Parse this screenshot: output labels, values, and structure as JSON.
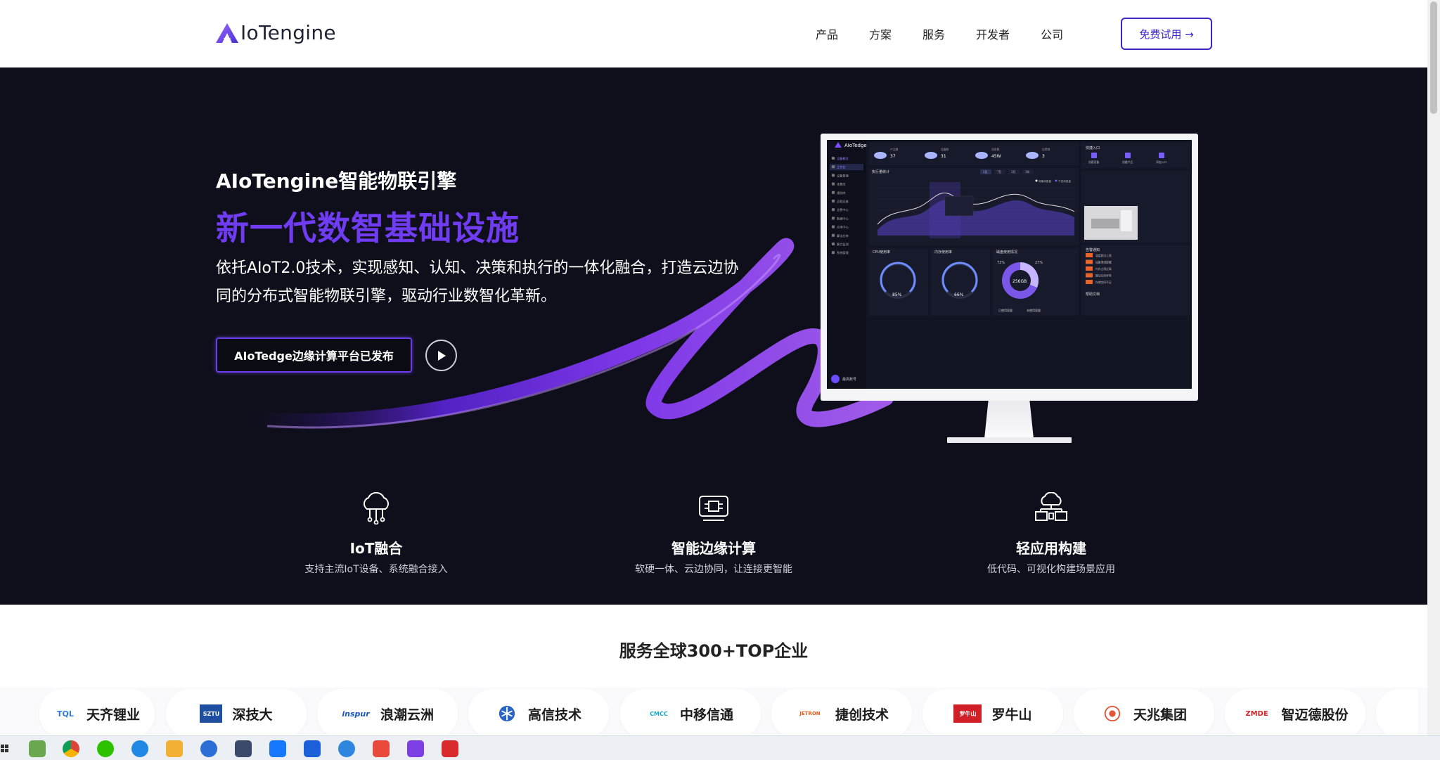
{
  "header": {
    "logo_text": "IoTengine",
    "nav": [
      "产品",
      "方案",
      "服务",
      "开发者",
      "公司"
    ],
    "trial_button": "免费试用 →"
  },
  "hero": {
    "subtitle": "AIoTengine智能物联引擎",
    "title": "新一代数智基础设施",
    "description": "依托AIoT2.0技术，实现感知、认知、决策和执行的一体化融合，打造云边协同的分布式智能物联引擎，驱动行业数智化革新。",
    "release_button": "AIoTedge边缘计算平台已发布"
  },
  "dashboard": {
    "brand": "AIoTedge",
    "menu": [
      "设备概览",
      "工作台",
      "设备管理",
      "场景库",
      "规则库",
      "远程运维",
      "告警中心",
      "数据中心",
      "应用中心",
      "算法仓库",
      "算力监测",
      "系统管理"
    ],
    "stats": [
      {
        "label": "产品数",
        "value": "37"
      },
      {
        "label": "设备数",
        "value": "31"
      },
      {
        "label": "消息数",
        "value": "45W"
      },
      {
        "label": "告警数",
        "value": "3"
      }
    ],
    "quick_entry": "快捷入口",
    "quick_items": [
      "创建设备",
      "创建产品",
      "添加入口"
    ],
    "chart_title": "执行量统计",
    "chart_tabs": [
      "1日",
      "7日",
      "1月",
      "1年"
    ],
    "chart_legend": [
      "传输消息量",
      "下发消息量"
    ],
    "cpu_title": "CPU使用率",
    "cpu_value": "85%",
    "mem_title": "内存使用率",
    "mem_value": "66%",
    "disk_title": "磁盘使用情况",
    "disk_total": "256GB",
    "disk_used": "73%",
    "disk_free": "27%",
    "disk_legend": [
      "已使用容量",
      "未使用容量"
    ],
    "alarm_title": "告警通知",
    "alarm_items": [
      "温度超出上限",
      "设备离线提醒",
      "内存占用过高",
      "算法任务异常",
      "存储空间不足"
    ],
    "help_title": "帮助文档",
    "user": "最高账号"
  },
  "features": [
    {
      "title": "IoT融合",
      "desc": "支持主流IoT设备、系统融合接入"
    },
    {
      "title": "智能边缘计算",
      "desc": "软硬一体、云边协同，让连接更智能"
    },
    {
      "title": "轻应用构建",
      "desc": "低代码、可视化构建场景应用"
    }
  ],
  "clients_title": "服务全球300+TOP企业",
  "clients": [
    {
      "name": "天齐锂业",
      "mark": "TQL"
    },
    {
      "name": "深技大",
      "mark": "SZTU"
    },
    {
      "name": "浪潮云洲",
      "mark": "inspur"
    },
    {
      "name": "高信技术",
      "mark": ""
    },
    {
      "name": "中移信通",
      "mark": "CMCC"
    },
    {
      "name": "捷创技术",
      "mark": "JETRON"
    },
    {
      "name": "罗牛山",
      "mark": "罗牛山"
    },
    {
      "name": "天兆集团",
      "mark": ""
    },
    {
      "name": "智迈德股份",
      "mark": "ZMDE"
    }
  ],
  "colors": {
    "brand_purple": "#6f3cf2",
    "hero_bg": "#0f0f1c",
    "button_border": "#3b27c9"
  }
}
